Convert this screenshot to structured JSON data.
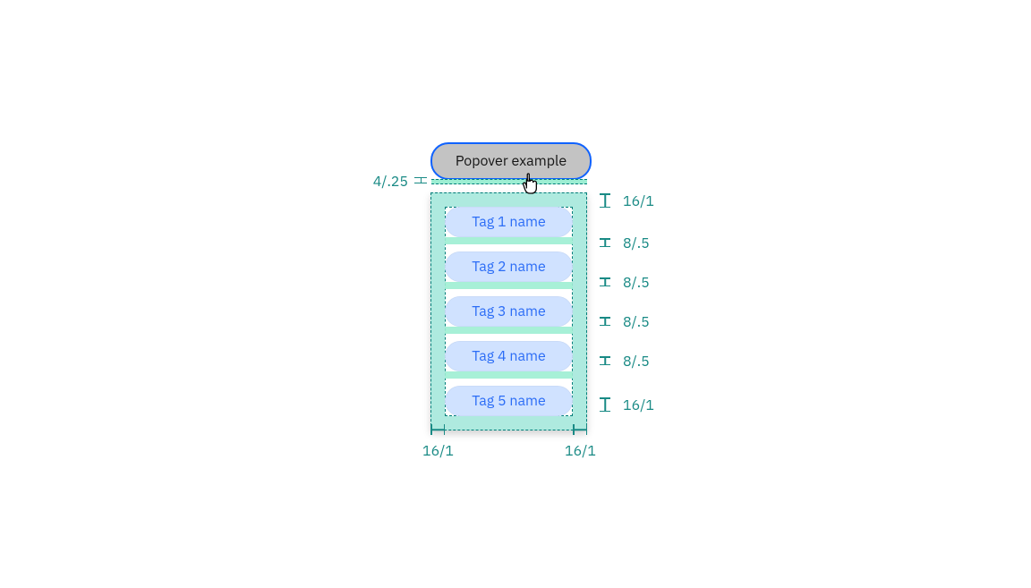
{
  "trigger": {
    "label": "Popover example"
  },
  "popover": {
    "tags": [
      {
        "label": "Tag 1 name"
      },
      {
        "label": "Tag 2 name"
      },
      {
        "label": "Tag 3 name"
      },
      {
        "label": "Tag 4 name"
      },
      {
        "label": "Tag 5 name"
      }
    ]
  },
  "spacing": {
    "trigger_gap": "4/.25",
    "padding_top": "16/1",
    "padding_bottom": "16/1",
    "padding_left": "16/1",
    "padding_right": "16/1",
    "item_gap_1": "8/.5",
    "item_gap_2": "8/.5",
    "item_gap_3": "8/.5",
    "item_gap_4": "8/.5"
  },
  "colors": {
    "teal": "#007d79",
    "teal_light": "#9deed3",
    "teal_medium": "#6cd9c5",
    "blue": "#2c6df6",
    "tag_bg": "#d0e2ff"
  }
}
